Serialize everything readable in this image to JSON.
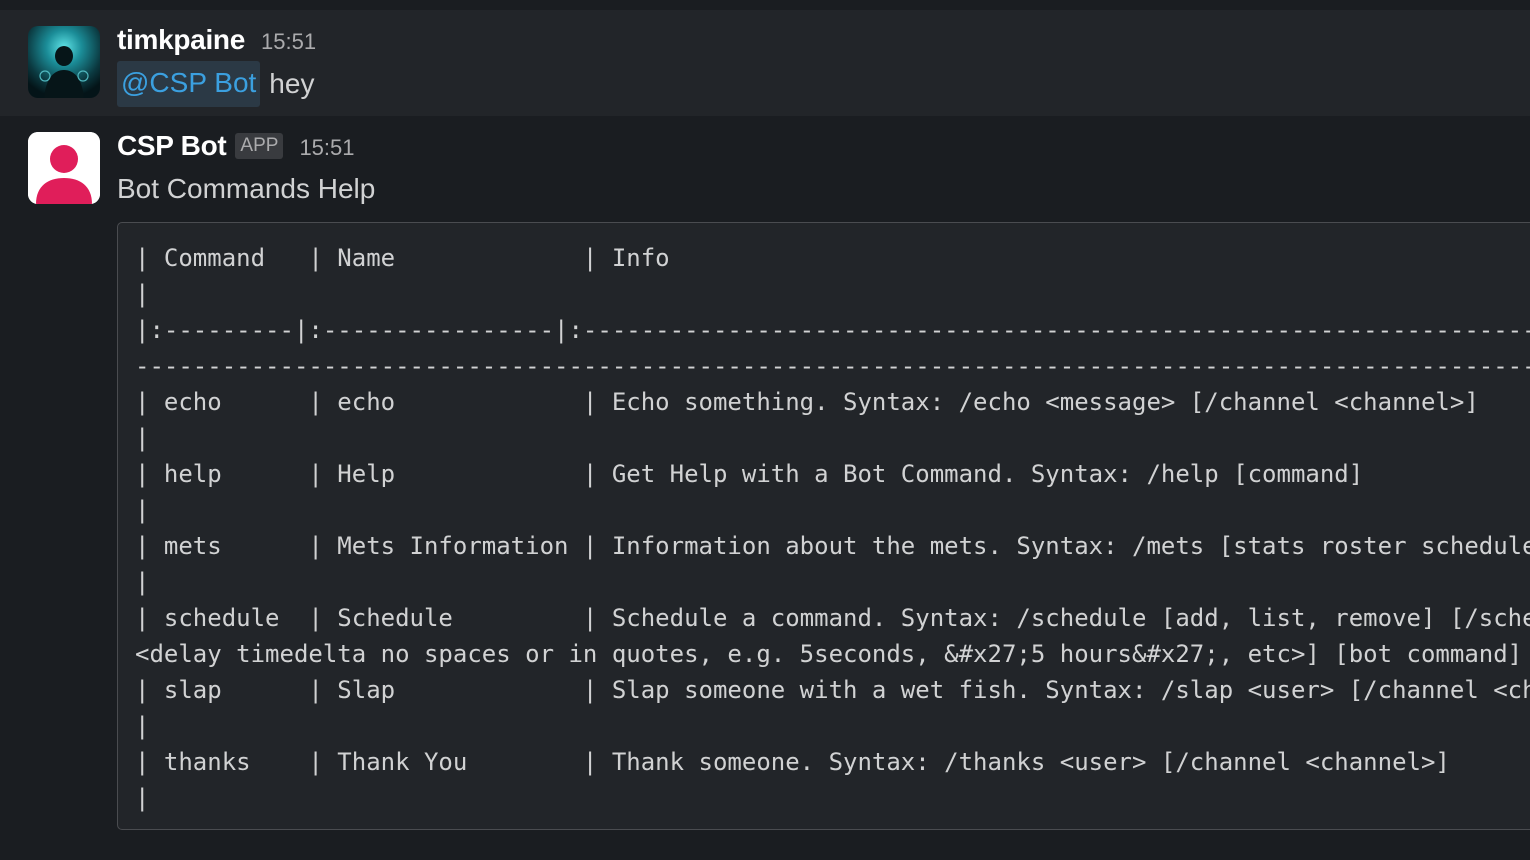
{
  "messages": [
    {
      "sender": "timkpaine",
      "time": "15:51",
      "mention": "@CSP Bot",
      "text": "hey",
      "avatar_icon": "user-photo-avatar"
    },
    {
      "sender": "CSP Bot",
      "badge": "APP",
      "time": "15:51",
      "text": "Bot Commands Help",
      "avatar_icon": "person-silhouette-icon",
      "avatar_color": "#e01e5a",
      "code_lines": [
        "| Command   | Name             | Info                                                                                          ",
        "|",
        "|:---------|:----------------|:----------------------------------------------------------------------------------------------",
        "-----------------------------------------------------------------------------------------------------------------------------",
        "| echo      | echo             | Echo something. Syntax: /echo <message> [/channel <channel>]",
        "|",
        "| help      | Help             | Get Help with a Bot Command. Syntax: /help [command]",
        "|",
        "| mets      | Mets Information | Information about the mets. Syntax: /mets [stats roster schedule",
        "|",
        "| schedule  | Schedule         | Schedule a command. Syntax: /schedule [add, list, remove] [/sche",
        "<delay timedelta no spaces or in quotes, e.g. 5seconds, &#x27;5 hours&#x27;, etc>] [bot command]",
        "| slap      | Slap             | Slap someone with a wet fish. Syntax: /slap <user> [/channel <ch",
        "|",
        "| thanks    | Thank You        | Thank someone. Syntax: /thanks <user> [/channel <channel>]",
        "|"
      ]
    }
  ],
  "colors": {
    "background": "#1a1d21",
    "hover_background": "#222529",
    "mention_text": "#3ba0e0",
    "mention_bg": "#2b3945"
  }
}
